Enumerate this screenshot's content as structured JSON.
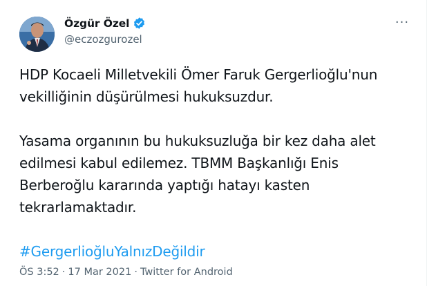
{
  "author": {
    "name": "Özgür Özel",
    "handle": "@eczozgurozel",
    "verified": true,
    "verified_color": "#1d9bf0"
  },
  "more_menu_label": "···",
  "tweet": {
    "line1": "HDP Kocaeli Milletvekili Ömer Faruk Gergerlioğlu'nun",
    "line2": "vekilliğinin düşürülmesi hukuksuzdur.",
    "line3": "Yasama organının bu hukuksuzluğa bir kez daha alet",
    "line4": "edilmesi kabul edilemez. TBMM Başkanlığı Enis",
    "line5": "Berberoğlu kararında yaptığı hatayı kasten",
    "line6": "tekrarlamaktadır.",
    "hashtag": "#GergerlioğluYalnızDeğildir"
  },
  "meta": {
    "time": "ÖS 3:52",
    "separator": "·",
    "date": "17 Mar 2021",
    "source": "Twitter for Android"
  },
  "colors": {
    "text": "#0f1419",
    "secondary": "#536471",
    "link": "#1d9bf0"
  }
}
